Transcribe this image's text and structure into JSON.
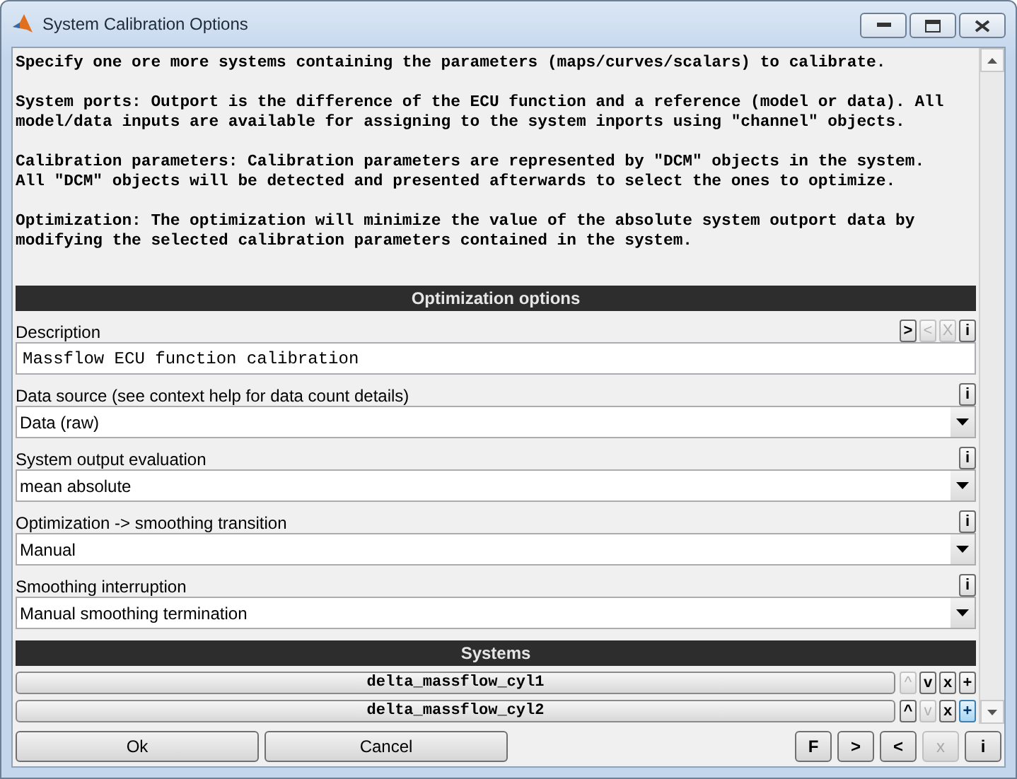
{
  "window": {
    "title": "System Calibration Options"
  },
  "intro": [
    {
      "lines": [
        "Specify one ore more systems containing the parameters (maps/curves/scalars) to calibrate."
      ]
    },
    {
      "lines": [
        "System ports: Outport is the difference of the ECU function and a reference (model or data). All",
        "model/data inputs are available for assigning to the system inports using \"channel\" objects."
      ]
    },
    {
      "lines": [
        "Calibration parameters: Calibration parameters are represented by \"DCM\" objects in the system.",
        "All \"DCM\" objects will be detected and presented afterwards to select the ones to optimize."
      ]
    },
    {
      "lines": [
        "Optimization: The optimization will minimize the value of the absolute system outport data by",
        "modifying the selected calibration parameters contained in the system."
      ]
    }
  ],
  "options": {
    "heading": "Optimization options",
    "fields": [
      {
        "kind": "text",
        "label": "Description",
        "value": "Massflow ECU function calibration",
        "buttons": [
          {
            "label": ">",
            "disabled": false
          },
          {
            "label": "<",
            "disabled": true
          },
          {
            "label": "X",
            "disabled": true
          },
          {
            "label": "i",
            "disabled": false
          }
        ]
      },
      {
        "kind": "dropdown",
        "label": "Data source (see context help for data count details)",
        "value": "Data (raw)",
        "buttons": [
          {
            "label": "i",
            "disabled": false
          }
        ]
      },
      {
        "kind": "dropdown",
        "label": "System output evaluation",
        "value": "mean absolute",
        "buttons": [
          {
            "label": "i",
            "disabled": false
          }
        ]
      },
      {
        "kind": "dropdown",
        "label": "Optimization -> smoothing transition",
        "value": "Manual",
        "buttons": [
          {
            "label": "i",
            "disabled": false
          }
        ]
      },
      {
        "kind": "dropdown",
        "label": "Smoothing interruption",
        "value": "Manual smoothing termination",
        "buttons": [
          {
            "label": "i",
            "disabled": false
          }
        ]
      }
    ]
  },
  "systems": {
    "heading": "Systems",
    "rows": [
      {
        "name": "delta_massflow_cyl1",
        "buttons": [
          {
            "label": "^",
            "disabled": true,
            "focused": false
          },
          {
            "label": "v",
            "disabled": false,
            "focused": false
          },
          {
            "label": "x",
            "disabled": false,
            "focused": false
          },
          {
            "label": "+",
            "disabled": false,
            "focused": false
          }
        ]
      },
      {
        "name": "delta_massflow_cyl2",
        "buttons": [
          {
            "label": "^",
            "disabled": false,
            "focused": false
          },
          {
            "label": "v",
            "disabled": true,
            "focused": false
          },
          {
            "label": "x",
            "disabled": false,
            "focused": false
          },
          {
            "label": "+",
            "disabled": false,
            "focused": true
          }
        ]
      }
    ]
  },
  "footer": {
    "buttons": [
      {
        "label": "Ok",
        "disabled": false
      },
      {
        "label": "Cancel",
        "disabled": false
      }
    ],
    "tools": [
      {
        "label": "F",
        "disabled": false
      },
      {
        "label": ">",
        "disabled": false
      },
      {
        "label": "<",
        "disabled": false
      },
      {
        "label": "x",
        "disabled": true
      },
      {
        "label": "i",
        "disabled": false
      }
    ]
  }
}
